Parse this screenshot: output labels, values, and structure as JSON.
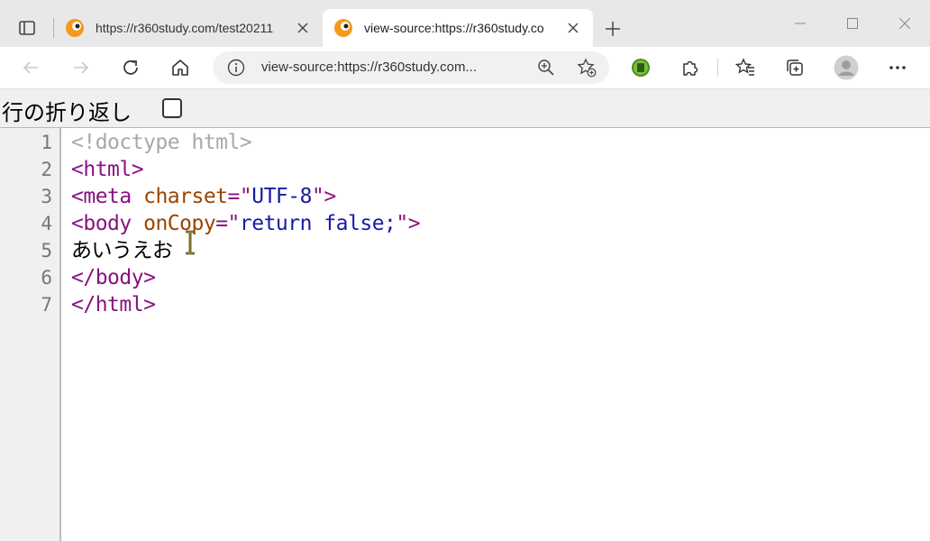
{
  "tabs": [
    {
      "title": "https://r360study.com/test20211"
    },
    {
      "title": "view-source:https://r360study.co"
    }
  ],
  "address_bar": {
    "url": "view-source:https://r360study.com..."
  },
  "wrap_option": {
    "label": "行の折り返し",
    "checked": false
  },
  "source": {
    "lines": [
      {
        "number": "1",
        "parts": [
          {
            "text": "<!doctype html>",
            "kind": "comment"
          }
        ]
      },
      {
        "number": "2",
        "parts": [
          {
            "text": "<html>",
            "kind": "tag"
          }
        ]
      },
      {
        "number": "3",
        "parts": [
          {
            "text": "<meta ",
            "kind": "tag"
          },
          {
            "text": "charset",
            "kind": "attr"
          },
          {
            "text": "=\"",
            "kind": "tag"
          },
          {
            "text": "UTF-8",
            "kind": "val"
          },
          {
            "text": "\">",
            "kind": "tag"
          }
        ]
      },
      {
        "number": "4",
        "parts": [
          {
            "text": "<body ",
            "kind": "tag"
          },
          {
            "text": "onCopy",
            "kind": "attr"
          },
          {
            "text": "=\"",
            "kind": "tag"
          },
          {
            "text": "return false;",
            "kind": "val"
          },
          {
            "text": "\">",
            "kind": "tag"
          }
        ]
      },
      {
        "number": "5",
        "parts": [
          {
            "text": "あいうえお",
            "kind": "text"
          }
        ]
      },
      {
        "number": "6",
        "parts": [
          {
            "text": "</body>",
            "kind": "tag"
          }
        ]
      },
      {
        "number": "7",
        "parts": [
          {
            "text": "</html>",
            "kind": "tag"
          }
        ]
      }
    ]
  },
  "colors": {
    "tag": "#881280",
    "attr": "#994500",
    "value": "#1a1aa6",
    "doctype": "#a8a8a8",
    "text": "#000000"
  },
  "icons": [
    "tab-actions-icon",
    "favicon-icon",
    "close-icon",
    "plus-icon",
    "minimize-icon",
    "maximize-icon",
    "back-icon",
    "forward-icon",
    "refresh-icon",
    "home-icon",
    "info-icon",
    "zoom-icon",
    "add-favorite-icon",
    "extension-green-icon",
    "puzzle-icon",
    "favorites-icon",
    "collections-icon",
    "profile-icon",
    "more-icon",
    "text-cursor-icon"
  ]
}
